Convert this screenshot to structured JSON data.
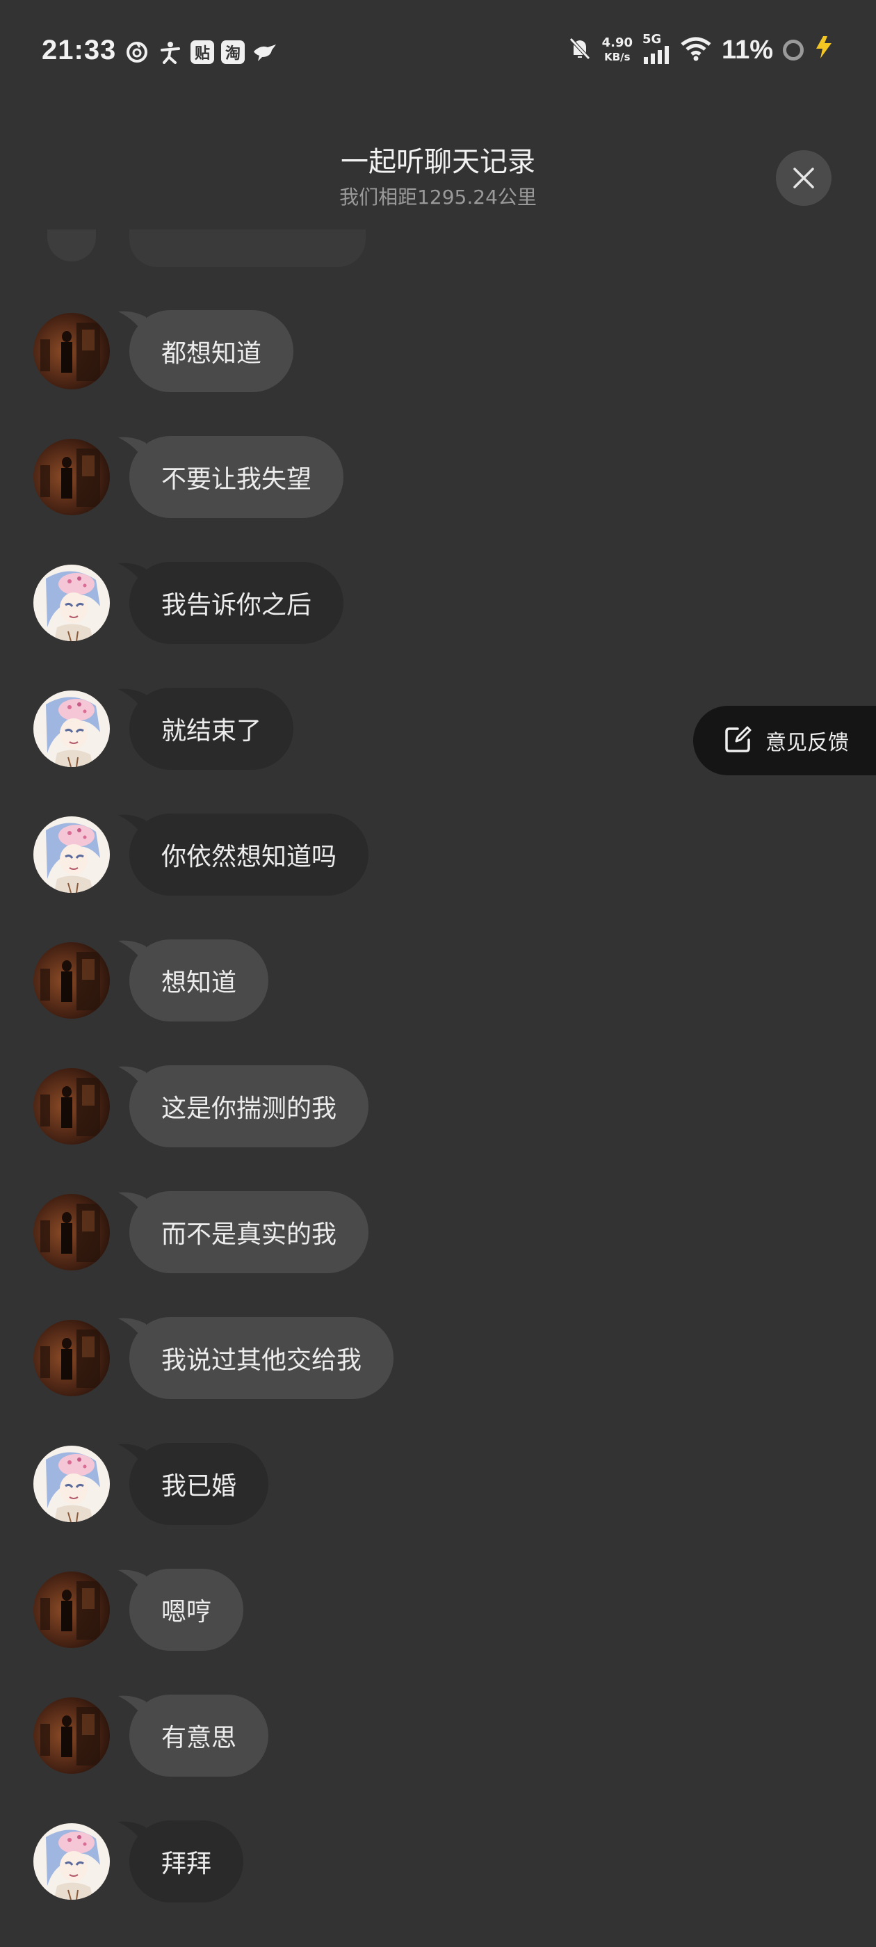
{
  "status_bar": {
    "time": "21:33",
    "net_speed_value": "4.90",
    "net_speed_unit": "KB/s",
    "network": "5G",
    "battery": "11%",
    "left_icons": [
      "netease-music-icon",
      "fitness-icon",
      "tieba-icon",
      "taobao-icon",
      "bird-icon"
    ],
    "left_box_labels": {
      "tieba": "贴",
      "taobao": "淘"
    }
  },
  "header": {
    "title": "一起听聊天记录",
    "subtitle": "我们相距1295.24公里",
    "close_icon": "close-icon"
  },
  "messages": [
    {
      "sender": "brown",
      "text": "都想知道",
      "style": "gray"
    },
    {
      "sender": "brown",
      "text": "不要让我失望",
      "style": "gray"
    },
    {
      "sender": "anime",
      "text": "我告诉你之后",
      "style": "dark"
    },
    {
      "sender": "anime",
      "text": "就结束了",
      "style": "dark"
    },
    {
      "sender": "anime",
      "text": "你依然想知道吗",
      "style": "dark"
    },
    {
      "sender": "brown",
      "text": "想知道",
      "style": "gray"
    },
    {
      "sender": "brown",
      "text": "这是你揣测的我",
      "style": "gray"
    },
    {
      "sender": "brown",
      "text": "而不是真实的我",
      "style": "gray"
    },
    {
      "sender": "brown",
      "text": "我说过其他交给我",
      "style": "gray"
    },
    {
      "sender": "anime",
      "text": "我已婚",
      "style": "dark"
    },
    {
      "sender": "brown",
      "text": "嗯哼",
      "style": "gray"
    },
    {
      "sender": "brown",
      "text": "有意思",
      "style": "gray"
    },
    {
      "sender": "anime",
      "text": "拜拜",
      "style": "dark"
    }
  ],
  "feedback": {
    "label": "意见反馈",
    "icon": "edit-icon"
  },
  "colors": {
    "background": "#333333",
    "bubble_gray": "#4a4a4a",
    "bubble_dark": "#2a2a2a",
    "feedback_bg": "#151515",
    "charging_bolt": "#f3c623"
  }
}
